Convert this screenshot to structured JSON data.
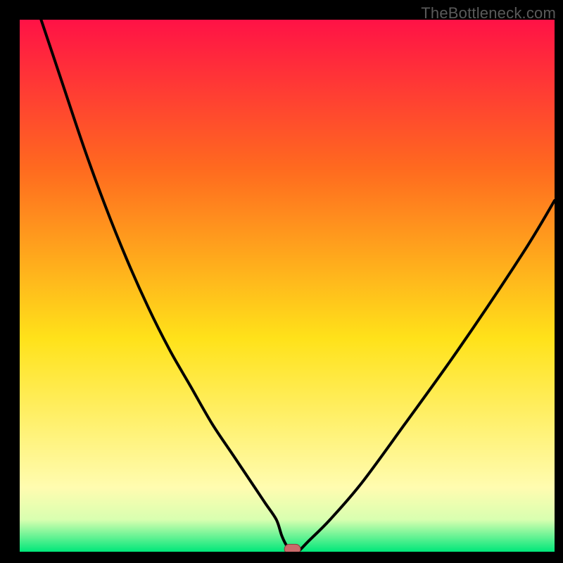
{
  "watermark": "TheBottleneck.com",
  "colors": {
    "frame": "#000000",
    "gradient_top": "#ff1246",
    "gradient_upper_mid": "#ff6a1f",
    "gradient_mid": "#ffe21a",
    "gradient_lower": "#fffcb0",
    "gradient_bottom": "#00e77a",
    "curve": "#000000",
    "marker_fill": "#c96a6a",
    "marker_stroke": "#8a3d3d"
  },
  "chart_data": {
    "type": "line",
    "title": "",
    "xlabel": "",
    "ylabel": "",
    "xlim": [
      0,
      100
    ],
    "ylim": [
      0,
      100
    ],
    "series": [
      {
        "name": "bottleneck-curve",
        "x": [
          4,
          8,
          12,
          16,
          20,
          24,
          28,
          32,
          36,
          40,
          44,
          46,
          48,
          49,
          50,
          51,
          52,
          54,
          58,
          64,
          72,
          82,
          94,
          100
        ],
        "y": [
          100,
          88,
          76,
          65,
          55,
          46,
          38,
          31,
          24,
          18,
          12,
          9,
          6,
          3,
          1,
          0,
          0,
          2,
          6,
          13,
          24,
          38,
          56,
          66
        ]
      }
    ],
    "marker": {
      "x": 51,
      "y": 0.5,
      "width": 3,
      "height": 1.8
    },
    "gradient_stops_pct": [
      0,
      28,
      60,
      88,
      94,
      100
    ]
  }
}
